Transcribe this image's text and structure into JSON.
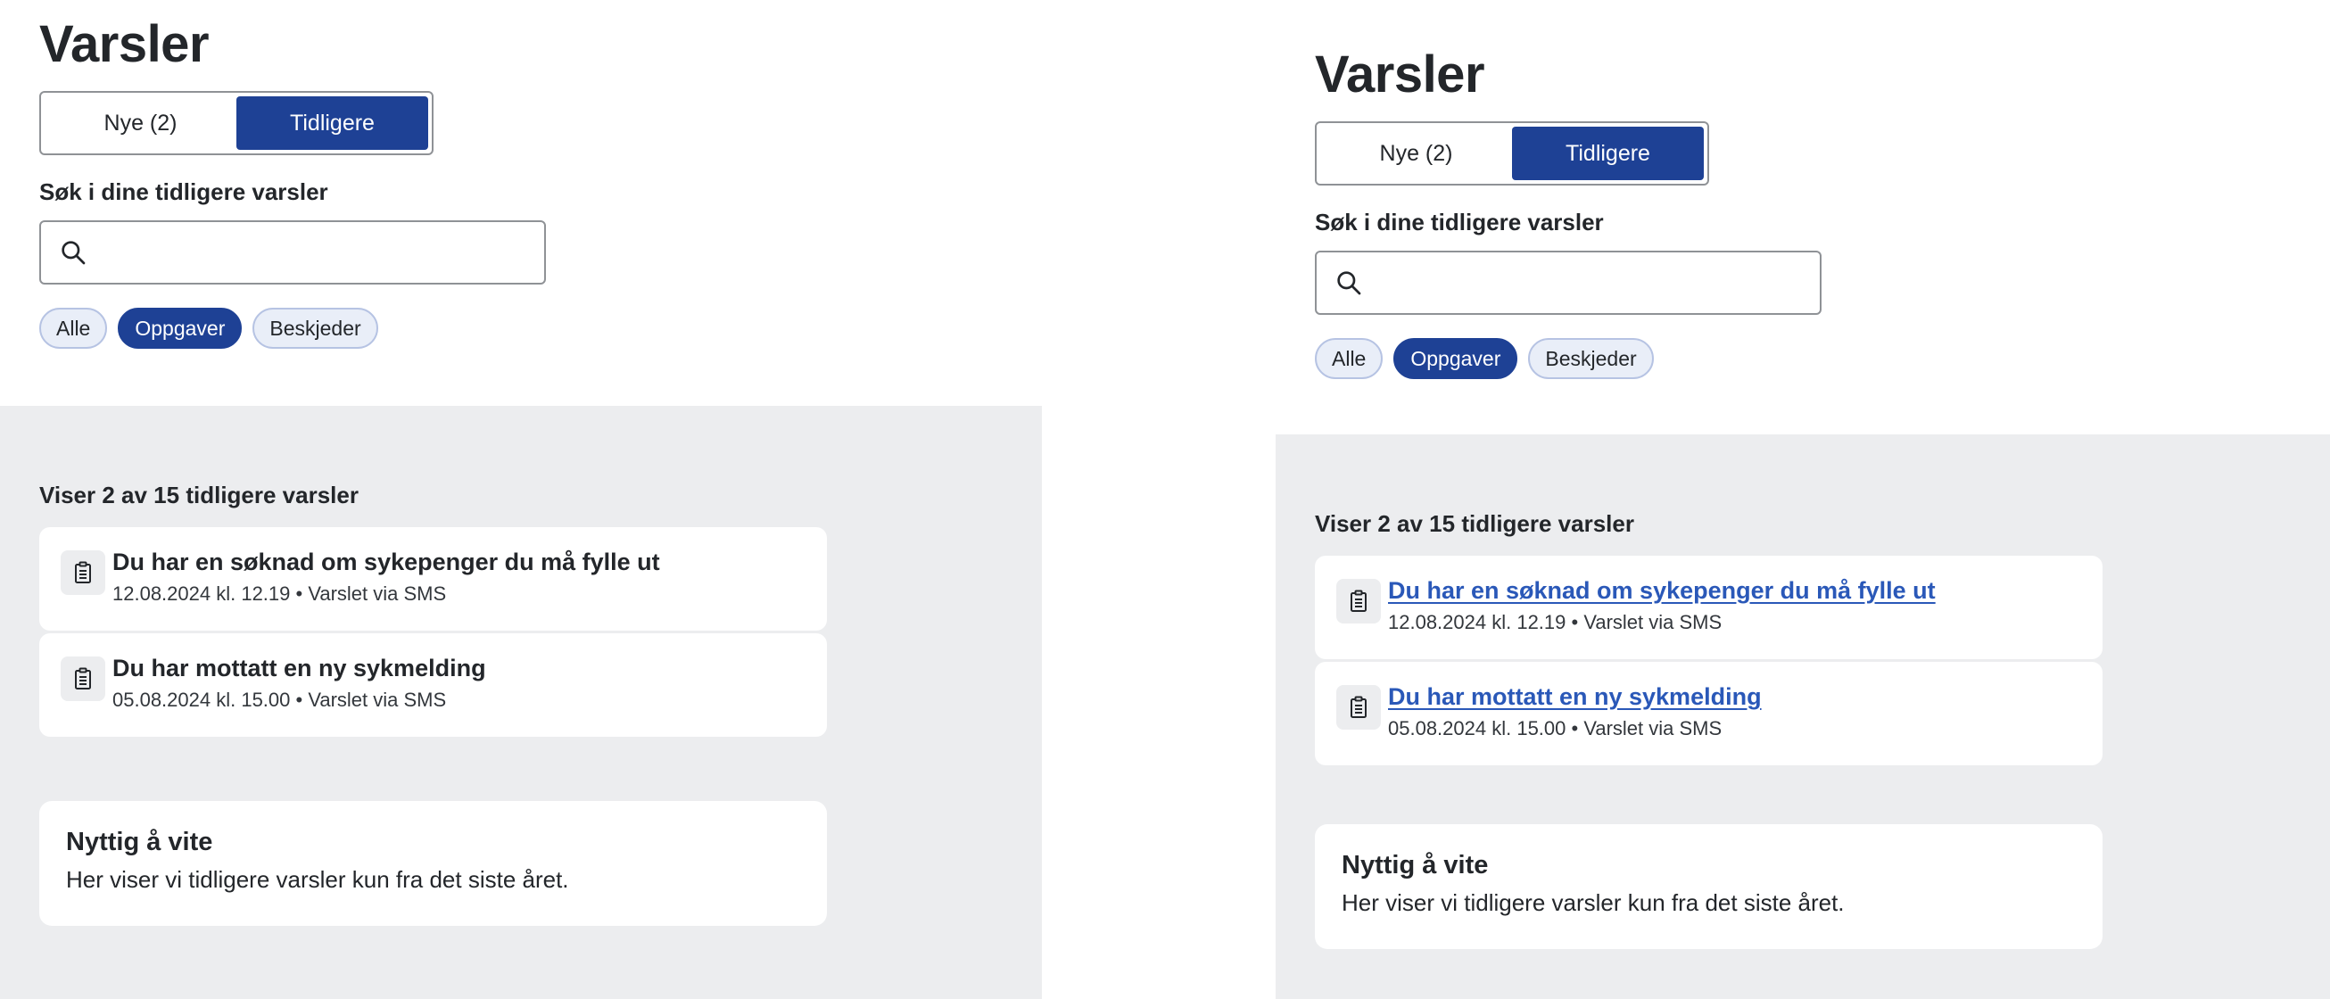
{
  "page": {
    "title": "Varsler",
    "toggle": {
      "new_label": "Nye (2)",
      "previous_label": "Tidligere"
    },
    "search": {
      "label": "Søk i dine tidligere varsler",
      "placeholder": ""
    },
    "filters": [
      "Alle",
      "Oppgaver",
      "Beskjeder"
    ],
    "count_text": "Viser 2 av 15 tidligere varsler",
    "notifications": [
      {
        "title": "Du har en søknad om sykepenger du må fylle ut",
        "meta": "12.08.2024 kl. 12.19 • Varslet via SMS"
      },
      {
        "title": "Du har mottatt en ny sykmelding",
        "meta": "05.08.2024 kl. 15.00 • Varslet via SMS"
      }
    ],
    "info": {
      "heading": "Nyttig å vite",
      "body": "Her viser vi tidligere varsler kun fra det siste året."
    }
  },
  "colors": {
    "accent": "#1e4195",
    "link": "#2a58b8",
    "panel_gray": "#ecedef"
  },
  "icons": {
    "search": "search-icon",
    "task": "clipboard-icon"
  }
}
